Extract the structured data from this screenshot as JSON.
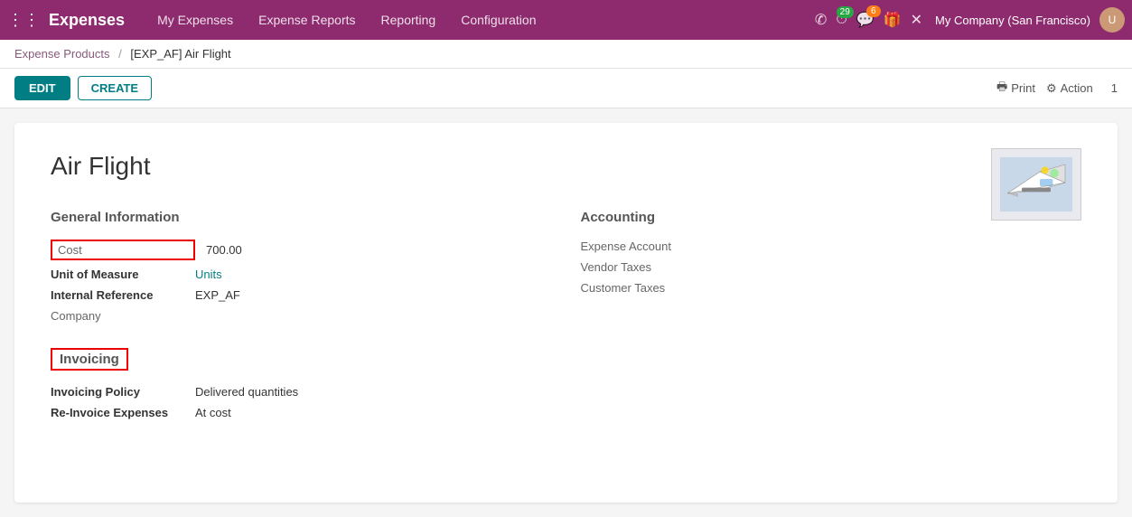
{
  "app": {
    "title": "Expenses",
    "grid_icon": "⊞"
  },
  "topnav": {
    "menu_items": [
      "My Expenses",
      "Expense Reports",
      "Reporting",
      "Configuration"
    ],
    "company": "My Company (San Francisco)",
    "badge_green": "29",
    "badge_orange": "6"
  },
  "breadcrumb": {
    "parent": "Expense Products",
    "separator": "/",
    "current": "[EXP_AF] Air Flight"
  },
  "toolbar": {
    "edit_label": "EDIT",
    "create_label": "CREATE",
    "print_label": "Print",
    "action_label": "Action",
    "page_number": "1"
  },
  "record": {
    "title": "Air Flight",
    "general_info_heading": "General Information",
    "accounting_heading": "Accounting",
    "invoicing_heading": "Invoicing",
    "fields": {
      "cost_label": "Cost",
      "cost_value": "700.00",
      "unit_of_measure_label": "Unit of Measure",
      "unit_of_measure_value": "Units",
      "internal_reference_label": "Internal Reference",
      "internal_reference_value": "EXP_AF",
      "company_label": "Company",
      "company_value": ""
    },
    "accounting_fields": {
      "expense_account_label": "Expense Account",
      "vendor_taxes_label": "Vendor Taxes",
      "customer_taxes_label": "Customer Taxes"
    },
    "invoicing_fields": {
      "invoicing_policy_label": "Invoicing Policy",
      "invoicing_policy_value": "Delivered quantities",
      "reinvoice_label": "Re-Invoice Expenses",
      "reinvoice_value": "At cost"
    }
  }
}
